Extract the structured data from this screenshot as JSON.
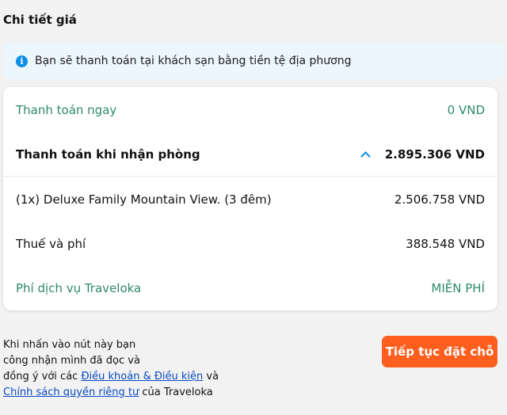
{
  "header": {
    "title": "Chi tiết giá"
  },
  "info": {
    "text": "Bạn sẽ thanh toán tại khách sạn bằng tiền tệ địa phương",
    "icon": "info-icon"
  },
  "price": {
    "pay_now": {
      "label": "Thanh toán ngay",
      "amount": "0 VND"
    },
    "pay_at_checkin": {
      "label": "Thanh toán khi nhận phòng",
      "amount": "2.895.306 VND",
      "icon": "chevron-up-icon"
    },
    "room": {
      "label": "(1x) Deluxe Family Mountain View. (3 đêm)",
      "amount": "2.506.758 VND"
    },
    "tax": {
      "label": "Thuế và phí",
      "amount": "388.548 VND"
    },
    "service_fee": {
      "label": "Phí dịch vụ Traveloka",
      "amount": "MIỄN PHÍ"
    }
  },
  "terms": {
    "line1": "Khi nhấn vào nút này bạn",
    "line2": "công nhận mình đã đọc và",
    "line3_pre": "đồng ý với các ",
    "terms_link": "Điều khoản & Điều kiện",
    "line3_post": " và",
    "privacy_link": "Chính sách quyền riêng tư",
    "line4_post": " của Traveloka"
  },
  "cta": {
    "label": "Tiếp tục đặt chỗ"
  },
  "colors": {
    "green": "#2f8a6a",
    "accent_orange": "#ff5e1f",
    "info_blue": "#0e8ee8",
    "link": "#0a4ac6"
  }
}
